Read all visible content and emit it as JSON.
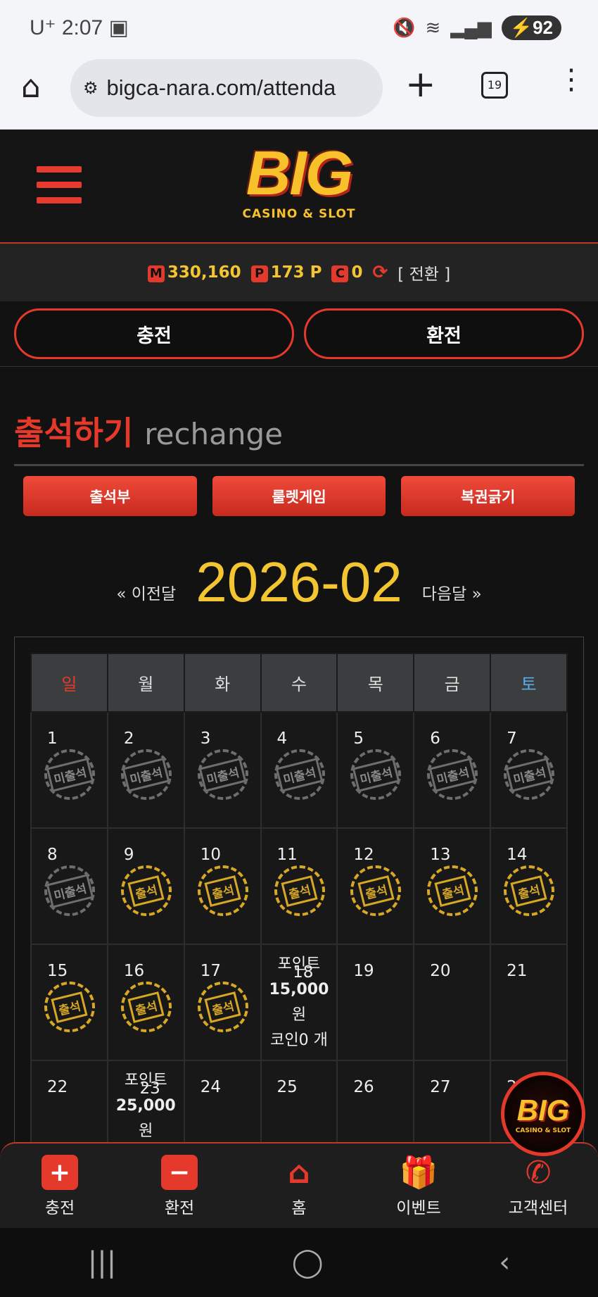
{
  "status_bar": {
    "carrier": "U⁺",
    "time": "2:07",
    "battery": "92"
  },
  "browser": {
    "url": "bigca-nara.com/attenda",
    "tab_count": "19"
  },
  "site": {
    "logo_text": "BIG",
    "logo_sub": "CASINO & SLOT",
    "balance": {
      "money_tag": "M",
      "money": "330,160",
      "point_tag": "P",
      "points": "173 P",
      "coin_tag": "C",
      "coins": "0",
      "switch": "[ 전환 ]"
    },
    "buttons": {
      "charge": "충전",
      "exchange": "환전"
    },
    "page_title": {
      "ko": "출석하기",
      "en": "rechange"
    },
    "tabs": [
      "출석부",
      "룰렛게임",
      "복권긁기"
    ],
    "month_nav": {
      "prev": "« 이전달",
      "current": "2026-02",
      "next": "다음달 »"
    },
    "weekdays": [
      "일",
      "월",
      "화",
      "수",
      "목",
      "금",
      "토"
    ],
    "weekday_colors": {
      "sun": "#e5392c",
      "sat": "#5aaee8"
    },
    "stamp_labels": {
      "missed": "미출석",
      "attended": "출석"
    },
    "weeks": [
      [
        {
          "d": "1",
          "s": "missed"
        },
        {
          "d": "2",
          "s": "missed"
        },
        {
          "d": "3",
          "s": "missed"
        },
        {
          "d": "4",
          "s": "missed"
        },
        {
          "d": "5",
          "s": "missed"
        },
        {
          "d": "6",
          "s": "missed"
        },
        {
          "d": "7",
          "s": "missed"
        }
      ],
      [
        {
          "d": "8",
          "s": "missed"
        },
        {
          "d": "9",
          "s": "attended"
        },
        {
          "d": "10",
          "s": "attended"
        },
        {
          "d": "11",
          "s": "attended"
        },
        {
          "d": "12",
          "s": "attended"
        },
        {
          "d": "13",
          "s": "attended"
        },
        {
          "d": "14",
          "s": "attended"
        }
      ],
      [
        {
          "d": "15",
          "s": "attended"
        },
        {
          "d": "16",
          "s": "attended"
        },
        {
          "d": "17",
          "s": "attended"
        },
        {
          "d": "18",
          "s": "reward",
          "r1": "포인트",
          "r2": "15,000",
          "r3": "원",
          "r4": "코인0 개"
        },
        {
          "d": "19"
        },
        {
          "d": "20"
        },
        {
          "d": "21"
        }
      ],
      [
        {
          "d": "22"
        },
        {
          "d": "23",
          "s": "reward",
          "r1": "포인트",
          "r2": "25,000",
          "r3": "원"
        },
        {
          "d": "24"
        },
        {
          "d": "25"
        },
        {
          "d": "26"
        },
        {
          "d": "27"
        },
        {
          "d": "28"
        }
      ]
    ],
    "bottom_nav": [
      {
        "label": "충전",
        "icon": "plus-icon",
        "glyph": "+"
      },
      {
        "label": "환전",
        "icon": "minus-icon",
        "glyph": "−"
      },
      {
        "label": "홈",
        "icon": "home-icon",
        "glyph": "⌂"
      },
      {
        "label": "이벤트",
        "icon": "gift-icon",
        "glyph": "🎁"
      },
      {
        "label": "고객센터",
        "icon": "phone-icon",
        "glyph": "✆"
      }
    ],
    "float_logo": {
      "text": "BIG",
      "sub": "CASINO & SLOT"
    }
  }
}
